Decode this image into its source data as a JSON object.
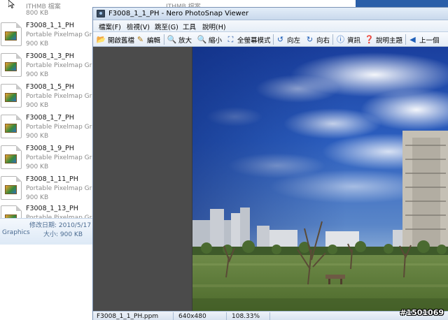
{
  "explorer": {
    "top_items": [
      {
        "name": "ITHMB 檔案",
        "size": "800 KB"
      },
      {
        "name": "ITHMB 檔案",
        "size": ""
      }
    ],
    "files": [
      {
        "name": "F3008_1_1_PH",
        "type": "Portable Pixelmap Graphics",
        "size": "900 KB"
      },
      {
        "name": "F3008_1_3_PH",
        "type": "Portable Pixelmap Graphics",
        "size": "900 KB"
      },
      {
        "name": "F3008_1_5_PH",
        "type": "Portable Pixelmap Graphics",
        "size": "900 KB"
      },
      {
        "name": "F3008_1_7_PH",
        "type": "Portable Pixelmap Graphics",
        "size": "900 KB"
      },
      {
        "name": "F3008_1_9_PH",
        "type": "Portable Pixelmap Graphics",
        "size": "900 KB"
      },
      {
        "name": "F3008_1_11_PH",
        "type": "Portable Pixelmap Graphics",
        "size": "900 KB"
      },
      {
        "name": "F3008_1_13_PH",
        "type": "Portable Pixelmap Graphics",
        "size": ""
      }
    ],
    "details": {
      "modified": "修改日期: 2010/5/17",
      "graphics": "Graphics",
      "size": "大小: 900 KB"
    }
  },
  "viewer": {
    "title": "F3008_1_1_PH - Nero PhotoSnap Viewer",
    "menu": [
      "檔案(F)",
      "檢視(V)",
      "跳至(G)",
      "工具",
      "說明(H)"
    ],
    "toolbar": [
      {
        "label": "開啟舊檔",
        "icon": "open-folder-icon",
        "glyph": "📂"
      },
      {
        "label": "編輯",
        "icon": "edit-icon",
        "glyph": "✎"
      },
      {
        "label": "放大",
        "icon": "zoom-in-icon",
        "glyph": "🔍"
      },
      {
        "label": "縮小",
        "icon": "zoom-out-icon",
        "glyph": "🔍"
      },
      {
        "label": "全螢幕模式",
        "icon": "fullscreen-icon",
        "glyph": "⛶"
      },
      {
        "label": "向左",
        "icon": "rotate-left-icon",
        "glyph": "↺"
      },
      {
        "label": "向右",
        "icon": "rotate-right-icon",
        "glyph": "↻"
      },
      {
        "label": "資訊",
        "icon": "info-icon",
        "glyph": "ⓘ"
      },
      {
        "label": "說明主題",
        "icon": "help-icon",
        "glyph": "❓"
      },
      {
        "label": "上一個",
        "icon": "previous-icon",
        "glyph": "◀"
      }
    ],
    "status": {
      "filename": "F3008_1_1_PH.ppm",
      "dimensions": "640x480",
      "zoom": "108.33%"
    },
    "colors": {
      "title_bar": "#d6e3f2",
      "viewer_bg": "#4b4b4b",
      "sky_top": "#1e44a8",
      "grass": "#5a7a34"
    }
  },
  "watermark": "#1501069"
}
